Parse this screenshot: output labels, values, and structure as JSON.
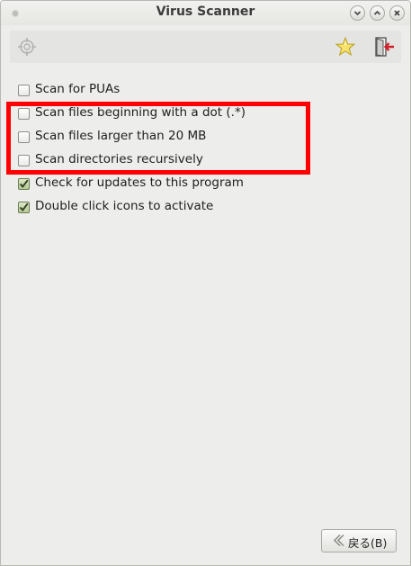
{
  "window": {
    "title": "Virus Scanner",
    "controls": {
      "minimize_icon": "chevron-down-icon",
      "maximize_icon": "chevron-up-icon",
      "close_icon": "close-icon"
    }
  },
  "toolbar": {
    "left_icon": "target-icon",
    "favorite_icon": "star-icon",
    "exit_icon": "exit-door-icon"
  },
  "options": [
    {
      "label": "Scan for PUAs",
      "checked": false
    },
    {
      "label": "Scan files beginning with a dot (.*)",
      "checked": false
    },
    {
      "label": "Scan files larger than 20 MB",
      "checked": false
    },
    {
      "label": "Scan directories recursively",
      "checked": false
    },
    {
      "label": "Check for updates to this program",
      "checked": true
    },
    {
      "label": "Double click icons to activate",
      "checked": true
    }
  ],
  "highlight_color": "#ff0000",
  "back_button": {
    "label": "戻る(B)",
    "icon": "back-arrow-icon"
  }
}
